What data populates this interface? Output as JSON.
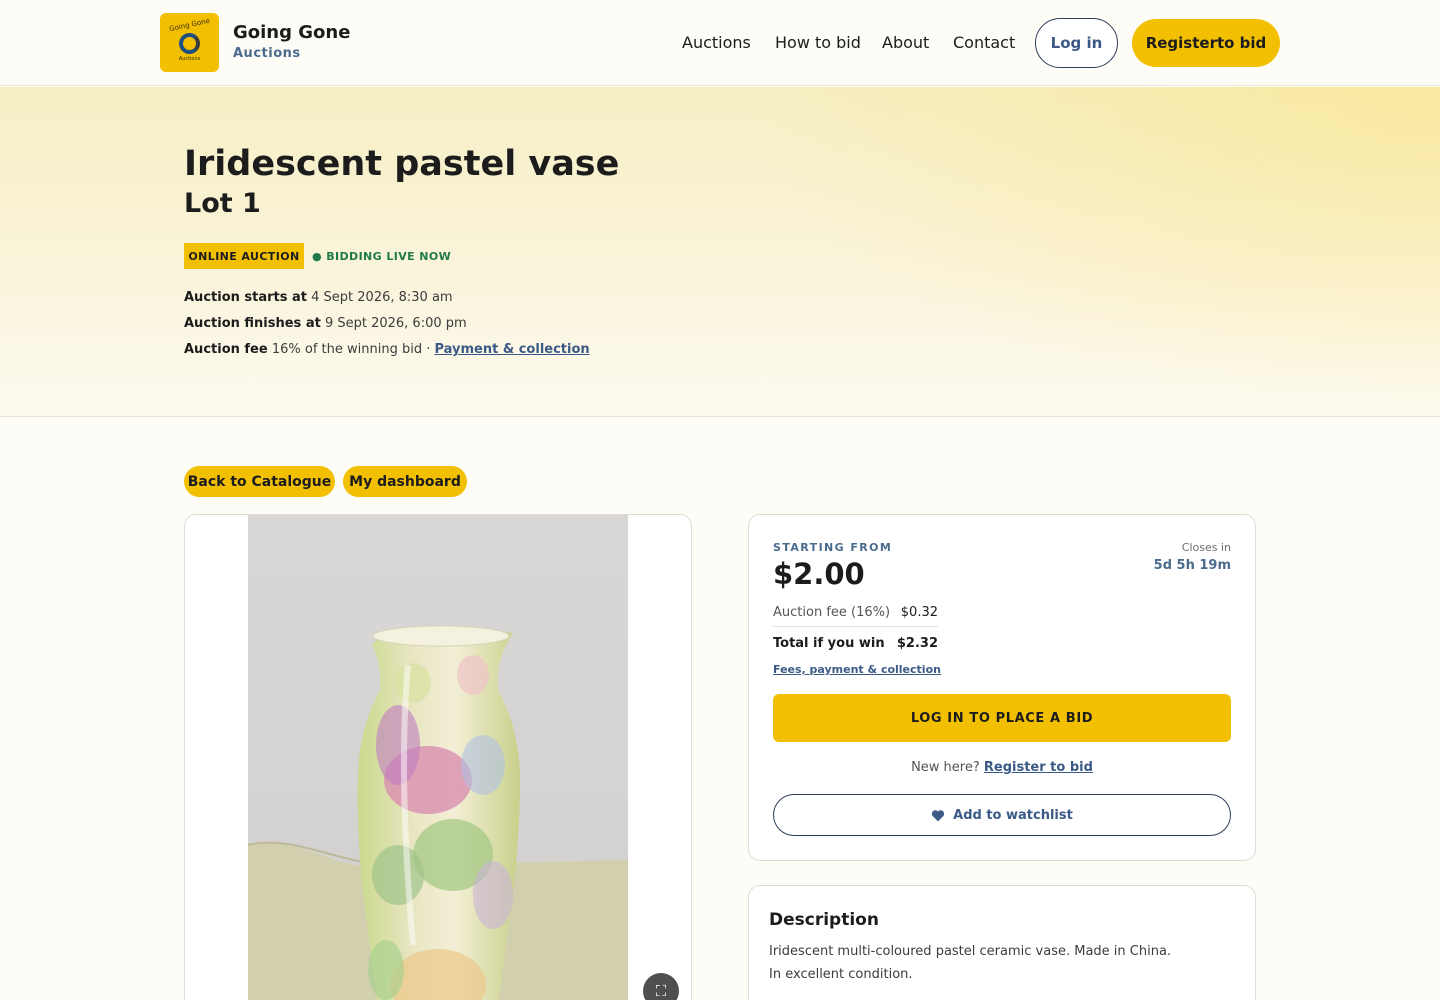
{
  "brand": {
    "name": "Going Gone",
    "sub": "Auctions",
    "logo_top": "Going Gone",
    "logo_bottom": "Auctions"
  },
  "nav": {
    "items": [
      "Auctions",
      "How to bid",
      "About",
      "Contact"
    ],
    "login": "Log in",
    "register": "Registerto bid"
  },
  "lot": {
    "title": "Iridescent pastel vase",
    "lot_label": "Lot 1",
    "badge_online": "ONLINE AUCTION",
    "badge_live": "● BIDDING LIVE NOW",
    "starts_label": "Auction starts at",
    "starts_value": "4 Sept 2026, 8:30 am",
    "finishes_label": "Auction finishes at",
    "finishes_value": "9 Sept 2026, 6:00 pm",
    "fee_label": "Auction fee",
    "fee_value": "16% of the winning bid ·",
    "fee_link": "Payment & collection"
  },
  "actions": {
    "back": "Back to Catalogue",
    "dashboard": "My dashboard"
  },
  "bid": {
    "starting_label": "STARTING FROM",
    "price": "$2.00",
    "closes_label": "Closes in",
    "closes_value": "5d 5h 19m",
    "fee_row_label": "Auction fee (16%)",
    "fee_row_value": "$0.32",
    "total_label": "Total if you win",
    "total_value": "$2.32",
    "fees_link": "Fees, payment & collection",
    "place_bid": "LOG IN TO PLACE A BID",
    "new_here": "New here?",
    "register_link": "Register to bid",
    "watchlist": "Add to watchlist"
  },
  "description": {
    "title": "Description",
    "lines": [
      "Iridescent multi-coloured pastel ceramic vase. Made in China.",
      "In excellent condition."
    ]
  },
  "colors": {
    "accent": "#f2c000",
    "navy": "#2d3e59",
    "link": "#3b5a86",
    "live": "#1f7a48"
  },
  "icons": {
    "expand": "expand-icon",
    "heart": "heart-icon",
    "logo_ring": "logo-ring-icon"
  }
}
